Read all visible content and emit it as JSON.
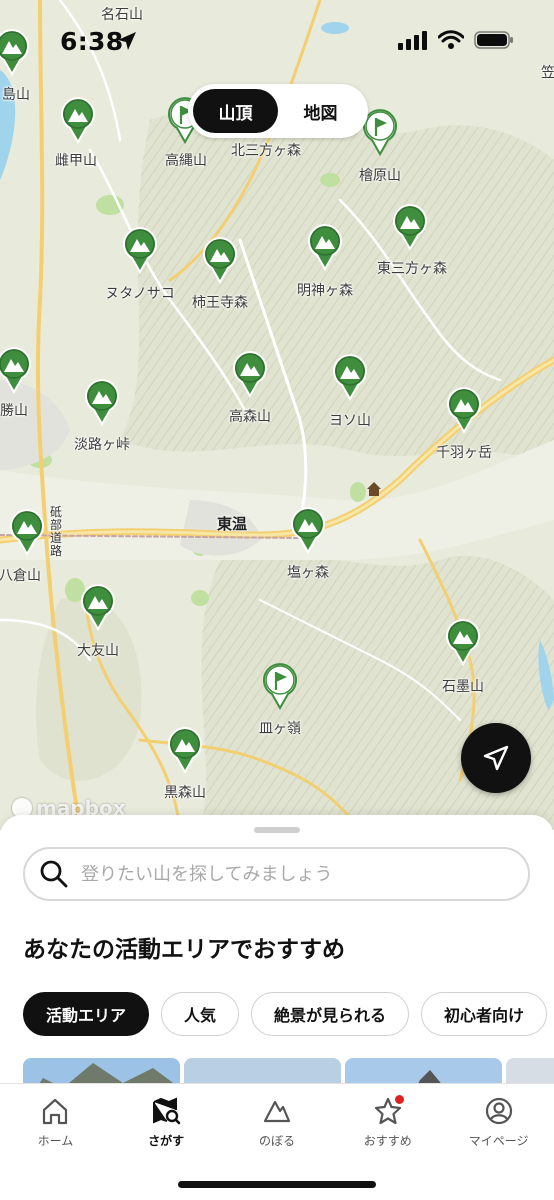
{
  "status_bar": {
    "time": "6:38"
  },
  "map": {
    "mode_toggle": [
      {
        "label": "山頂",
        "active": true
      },
      {
        "label": "地図",
        "active": false
      }
    ],
    "places": [
      {
        "name": "",
        "kind": "summit"
      },
      {
        "name": "雌甲山",
        "kind": "summit"
      },
      {
        "name": "高縄山",
        "kind": "flag"
      },
      {
        "name": "北三方ヶ森",
        "kind": "label"
      },
      {
        "name": "檜原山",
        "kind": "flag"
      },
      {
        "name": "ヌタノサコ",
        "kind": "summit"
      },
      {
        "name": "柿王寺森",
        "kind": "summit"
      },
      {
        "name": "明神ヶ森",
        "kind": "summit"
      },
      {
        "name": "東三方ヶ森",
        "kind": "summit"
      },
      {
        "name": "勝山",
        "kind": "summit"
      },
      {
        "name": "淡路ヶ峠",
        "kind": "summit"
      },
      {
        "name": "高森山",
        "kind": "summit"
      },
      {
        "name": "ヨソ山",
        "kind": "summit"
      },
      {
        "name": "千羽ヶ岳",
        "kind": "summit"
      },
      {
        "name": "塩ヶ森",
        "kind": "summit"
      },
      {
        "name": "八倉山",
        "kind": "summit"
      },
      {
        "name": "大友山",
        "kind": "summit"
      },
      {
        "name": "石墨山",
        "kind": "summit"
      },
      {
        "name": "皿ヶ嶺",
        "kind": "flag"
      },
      {
        "name": "黒森山",
        "kind": "summit"
      }
    ],
    "other_labels": {
      "town": "東温",
      "top_place": "名石山",
      "left_top": "島山",
      "right_top": "笠",
      "road": "砥部道路"
    },
    "attribution": "mapbox",
    "locate_button": {
      "icon": "location-arrow-icon"
    }
  },
  "sheet": {
    "search_placeholder": "登りたい山を探してみましょう",
    "section_title": "あなたの活動エリアでおすすめ",
    "chips": [
      {
        "label": "活動エリア",
        "active": true
      },
      {
        "label": "人気",
        "active": false
      },
      {
        "label": "絶景が見られる",
        "active": false
      },
      {
        "label": "初心者向け",
        "active": false
      }
    ]
  },
  "tabbar": {
    "items": [
      {
        "label": "ホーム",
        "icon": "home-icon",
        "active": false
      },
      {
        "label": "さがす",
        "icon": "map-search-icon",
        "active": true
      },
      {
        "label": "のぼる",
        "icon": "mountain-icon",
        "active": false
      },
      {
        "label": "おすすめ",
        "icon": "star-icon",
        "active": false,
        "badge": true
      },
      {
        "label": "マイページ",
        "icon": "person-icon",
        "active": false
      }
    ]
  },
  "colors": {
    "pin_green": "#3e8e3e",
    "accent_black": "#111111",
    "road_yellow": "#f3cf72",
    "water_blue": "#9fd4ec"
  }
}
